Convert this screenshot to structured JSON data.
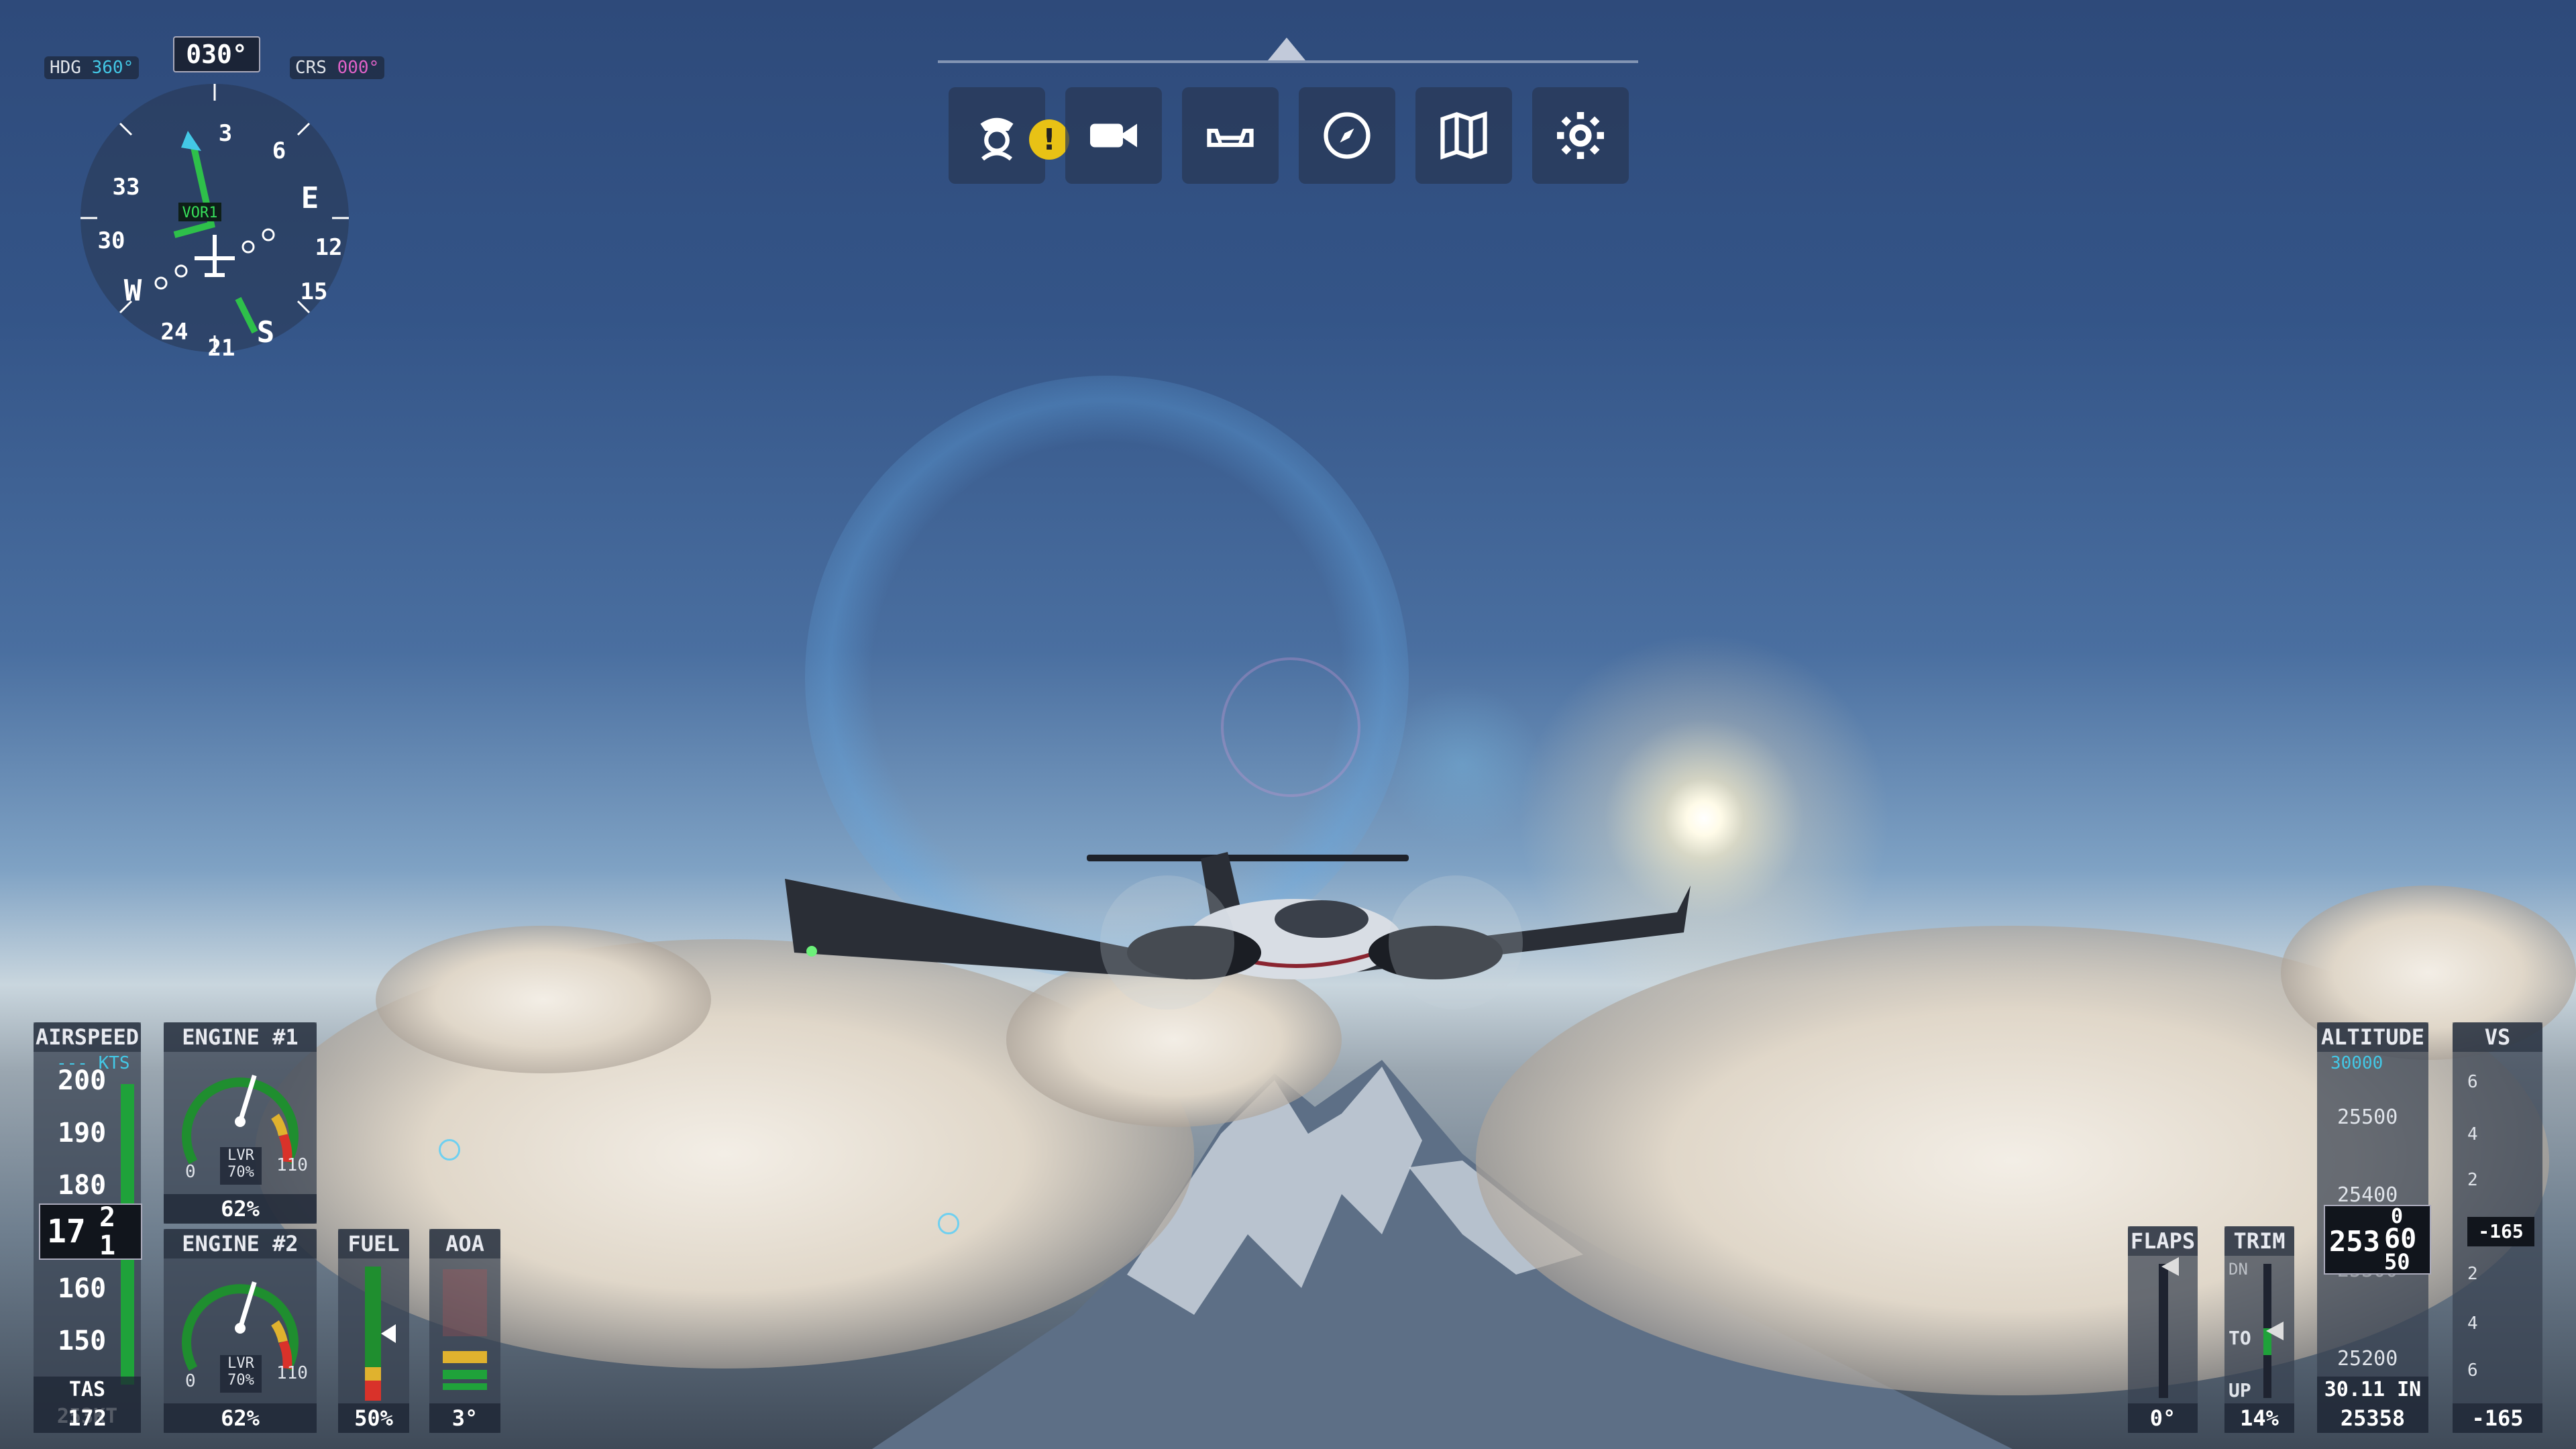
{
  "compass": {
    "heading_readout": "030°",
    "hdg_label": "HDG",
    "hdg_value": "360°",
    "crs_label": "CRS",
    "crs_value": "000°",
    "nav_source": "VOR1",
    "card_labels": [
      "3",
      "6",
      "E",
      "12",
      "15",
      "S",
      "21",
      "24",
      "W",
      "30",
      "33"
    ]
  },
  "toolbar": {
    "buttons": [
      {
        "name": "pilot-icon",
        "alert": "!"
      },
      {
        "name": "camera-icon"
      },
      {
        "name": "cockpit-view-icon"
      },
      {
        "name": "compass-icon"
      },
      {
        "name": "map-icon"
      },
      {
        "name": "gear-icon"
      }
    ]
  },
  "airspeed": {
    "title": "AIRSPEED",
    "bug": "--- KTS",
    "ticks": [
      "200",
      "190",
      "180",
      "160",
      "150"
    ],
    "current_major": "17",
    "current_upper": "2",
    "current_lower": "1",
    "tas": "TAS 253KT",
    "value": "172"
  },
  "engine1": {
    "title": "ENGINE #1",
    "lvr": "LVR",
    "lvr_pct": "70%",
    "min": "0",
    "max": "110",
    "value": "62%",
    "needle_pct": 62
  },
  "engine2": {
    "title": "ENGINE #2",
    "lvr": "LVR",
    "lvr_pct": "70%",
    "min": "0",
    "max": "110",
    "value": "62%",
    "needle_pct": 62
  },
  "fuel": {
    "title": "FUEL",
    "value": "50%",
    "level_pct": 50
  },
  "aoa": {
    "title": "AOA",
    "value": "3°"
  },
  "flaps": {
    "title": "FLAPS",
    "value": "0°"
  },
  "trim": {
    "title": "TRIM",
    "dn": "DN",
    "to": "TO",
    "up": "UP",
    "value": "14%"
  },
  "altitude": {
    "title": "ALTITUDE",
    "bug": "30000",
    "ticks": [
      "25500",
      "25400",
      "25300",
      "25200"
    ],
    "current_major": "253",
    "current_upper": "60",
    "current_lower": "50",
    "current_partial": "0",
    "baro": "30.11 IN",
    "value": "25358"
  },
  "vs": {
    "title": "VS",
    "ticks_up": [
      "6",
      "4",
      "2"
    ],
    "ticks_down": [
      "2",
      "4",
      "6"
    ],
    "current": "-165",
    "value": "-165"
  }
}
